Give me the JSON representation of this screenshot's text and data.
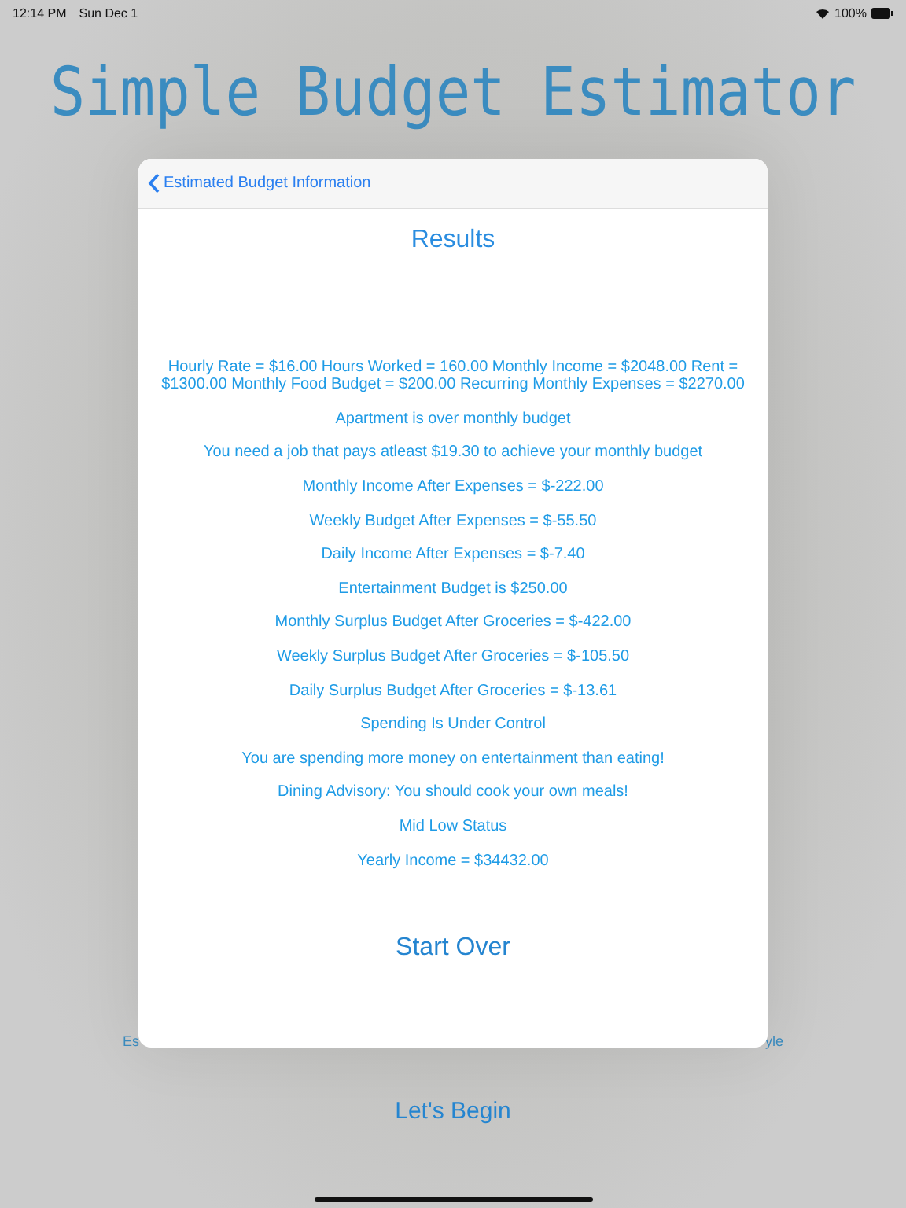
{
  "status_bar": {
    "time": "12:14 PM",
    "date": "Sun Dec 1",
    "battery": "100%"
  },
  "title": "Simple Budget Estimator",
  "background_fragments": [
    "Es",
    "yle"
  ],
  "background_button": "Let's Begin",
  "modal": {
    "back_label": "Estimated Budget Information",
    "heading": "Results",
    "lines": [
      "Hourly Rate = $16.00 Hours Worked = 160.00 Monthly Income = $2048.00 Rent = $1300.00 Monthly Food Budget = $200.00 Recurring Monthly Expenses = $2270.00",
      "Apartment is over monthly budget",
      "You need a job that pays atleast $19.30 to achieve your monthly budget",
      "Monthly Income After Expenses = $-222.00",
      "Weekly Budget After Expenses = $-55.50",
      "Daily Income After Expenses = $-7.40",
      "Entertainment Budget is $250.00",
      "Monthly Surplus Budget After Groceries =  $-422.00",
      "Weekly Surplus Budget After Groceries = $-105.50",
      "Daily Surplus Budget After Groceries = $-13.61",
      "Spending Is Under Control",
      "You are spending more money on entertainment than eating!",
      "Dining Advisory: You should cook your own meals!",
      "Mid Low Status",
      "Yearly Income = $34432.00"
    ],
    "button": "Start Over"
  }
}
